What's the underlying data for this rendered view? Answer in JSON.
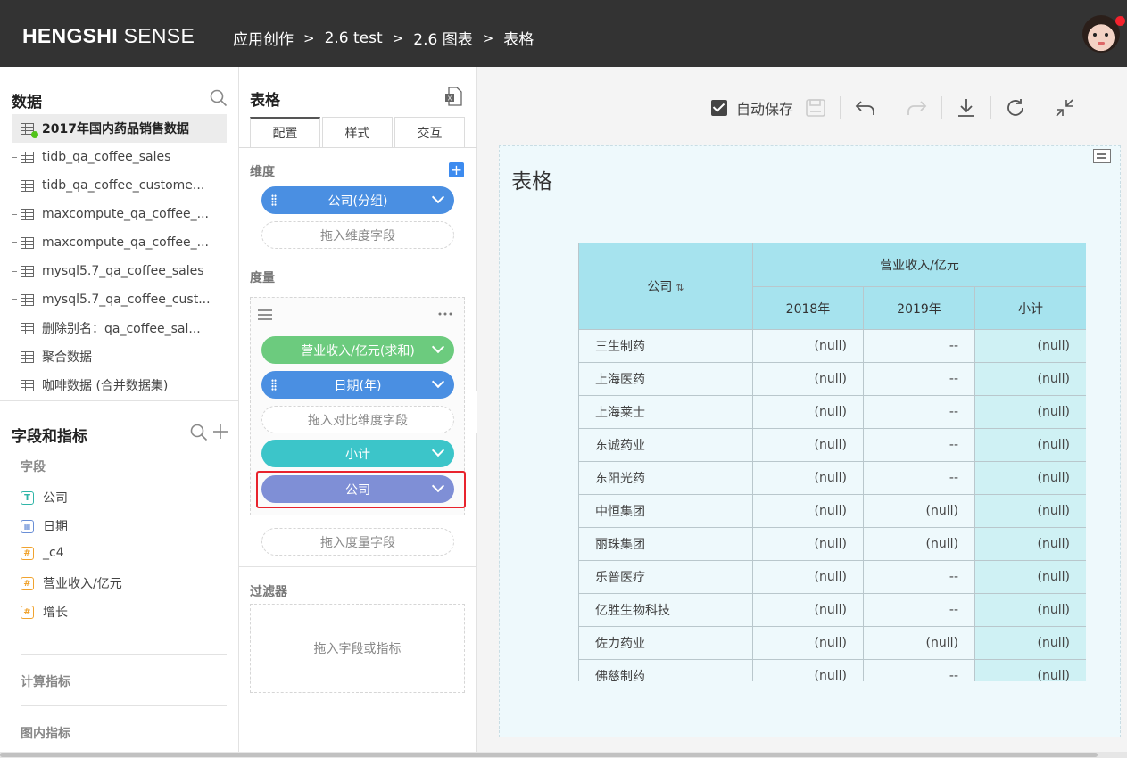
{
  "header": {
    "logo_bold": "HENGSHI",
    "logo_light": "SENSE",
    "breadcrumb": [
      "应用创作",
      "2.6 test",
      "2.6 图表",
      "表格"
    ],
    "separator": ">"
  },
  "left": {
    "data_title": "数据",
    "datasets": [
      "2017年国内药品销售数据",
      "tidb_qa_coffee_sales",
      "tidb_qa_coffee_custome...",
      "maxcompute_qa_coffee_...",
      "maxcompute_qa_coffee_...",
      "mysql5.7_qa_coffee_sales",
      "mysql5.7_qa_coffee_cust...",
      "删除别名：qa_coffee_sal...",
      "聚合数据",
      "咖啡数据 (合并数据集)"
    ],
    "fields_title": "字段和指标",
    "fields_group": "字段",
    "fields": [
      {
        "label": "公司",
        "type": "T"
      },
      {
        "label": "日期",
        "type": "date"
      },
      {
        "label": "_c4",
        "type": "#"
      },
      {
        "label": "营业收入/亿元",
        "type": "#"
      },
      {
        "label": "增长",
        "type": "#"
      }
    ],
    "calc_metrics": "计算指标",
    "chart_metrics": "图内指标"
  },
  "mid": {
    "title": "表格",
    "tabs": [
      "配置",
      "样式",
      "交互"
    ],
    "dimension_label": "维度",
    "dimension_pill": "公司(分组)",
    "dimension_drop": "拖入维度字段",
    "measure_label": "度量",
    "measure_pills": [
      "营业收入/亿元(求和)",
      "日期(年)",
      "小计",
      "公司"
    ],
    "compare_drop": "拖入对比维度字段",
    "measure_drop": "拖入度量字段",
    "filter_label": "过滤器",
    "filter_drop": "拖入字段或指标",
    "colors": {
      "green": "#6ccb7e",
      "blue": "#4a8fe2",
      "teal": "#3cc5c9",
      "purple": "#7f8fd6"
    }
  },
  "toolbar": {
    "autosave_label": "自动保存"
  },
  "chart": {
    "title": "表格",
    "table": {
      "row_header": "公司",
      "group_header": "营业收入/亿元",
      "columns": [
        "2018年",
        "2019年",
        "小计"
      ],
      "rows": [
        [
          "三生制药",
          "(null)",
          "--",
          "(null)"
        ],
        [
          "上海医药",
          "(null)",
          "--",
          "(null)"
        ],
        [
          "上海莱士",
          "(null)",
          "--",
          "(null)"
        ],
        [
          "东诚药业",
          "(null)",
          "--",
          "(null)"
        ],
        [
          "东阳光药",
          "(null)",
          "--",
          "(null)"
        ],
        [
          "中恒集团",
          "(null)",
          "(null)",
          "(null)"
        ],
        [
          "丽珠集团",
          "(null)",
          "(null)",
          "(null)"
        ],
        [
          "乐普医疗",
          "(null)",
          "--",
          "(null)"
        ],
        [
          "亿胜生物科技",
          "(null)",
          "--",
          "(null)"
        ],
        [
          "佐力药业",
          "(null)",
          "(null)",
          "(null)"
        ],
        [
          "佛慈制药",
          "(null)",
          "--",
          "(null)"
        ]
      ]
    }
  }
}
